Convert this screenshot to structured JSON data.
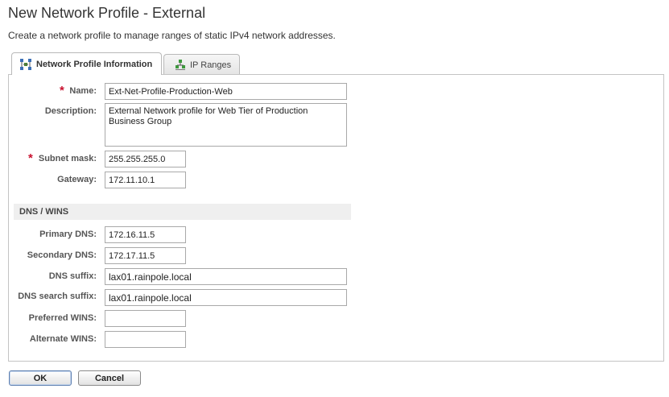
{
  "header": {
    "title": "New Network Profile - External",
    "subtitle": "Create a network profile to manage ranges of static IPv4 network addresses."
  },
  "tabs": [
    {
      "label": "Network Profile Information",
      "active": true,
      "icon": "network-icon"
    },
    {
      "label": "IP Ranges",
      "active": false,
      "icon": "ip-ranges-icon"
    }
  ],
  "form": {
    "name": {
      "label": "Name:",
      "value": "Ext-Net-Profile-Production-Web",
      "required": true
    },
    "description": {
      "label": "Description:",
      "value": "External Network profile for Web Tier of Production Business Group"
    },
    "subnet_mask": {
      "label": "Subnet mask:",
      "value": "255.255.255.0",
      "required": true
    },
    "gateway": {
      "label": "Gateway:",
      "value": "172.11.10.1"
    },
    "required_marker": "*"
  },
  "dns_section": {
    "title": "DNS / WINS",
    "primary_dns": {
      "label": "Primary DNS:",
      "value": "172.16.11.5"
    },
    "secondary_dns": {
      "label": "Secondary DNS:",
      "value": "172.17.11.5"
    },
    "dns_suffix": {
      "label": "DNS suffix:",
      "value": "lax01.rainpole.local"
    },
    "dns_search_suffix": {
      "label": "DNS search suffix:",
      "value": "lax01.rainpole.local"
    },
    "preferred_wins": {
      "label": "Preferred WINS:",
      "value": ""
    },
    "alternate_wins": {
      "label": "Alternate WINS:",
      "value": ""
    }
  },
  "buttons": {
    "ok": "OK",
    "cancel": "Cancel"
  },
  "colors": {
    "required": "#c8102e",
    "section_bg": "#efefef",
    "ok_border": "#5d7fb0"
  }
}
